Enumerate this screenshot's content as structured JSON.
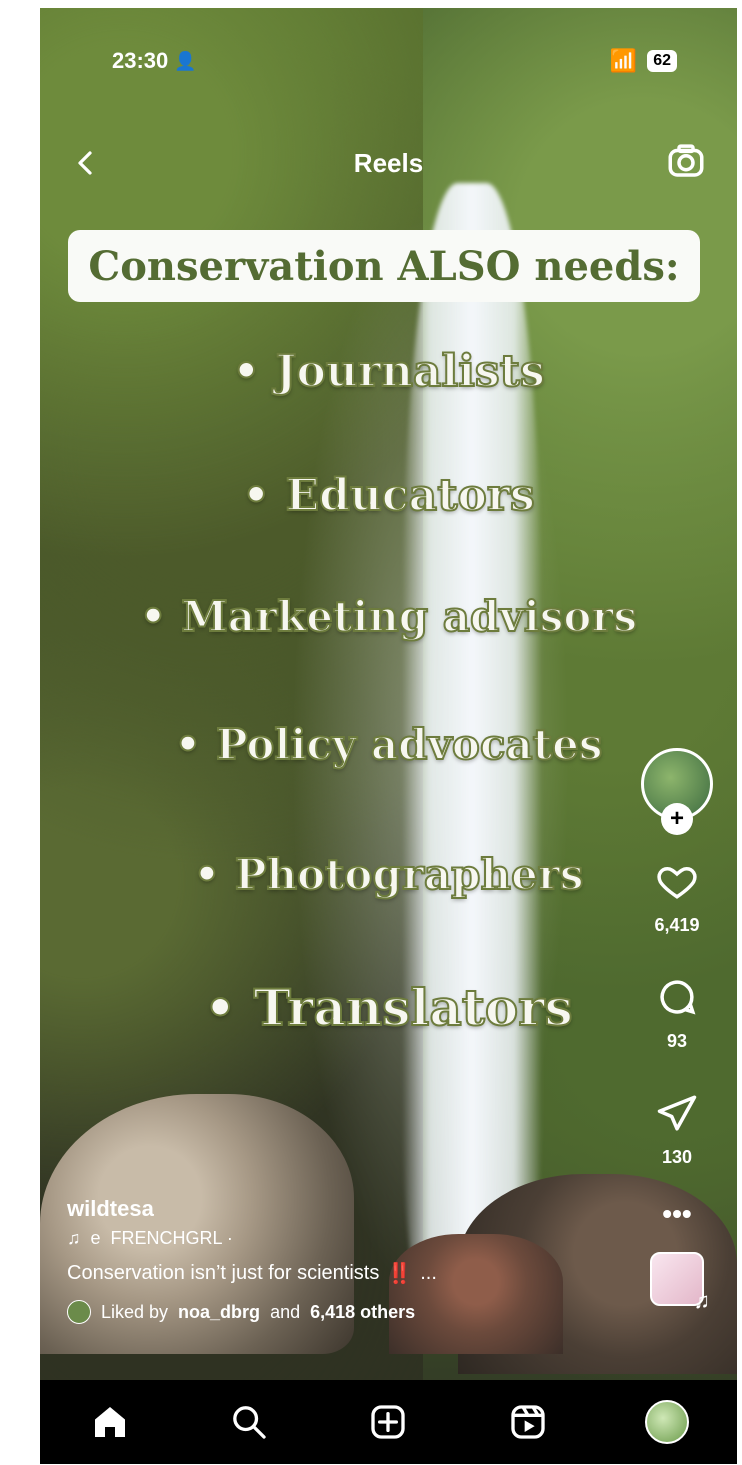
{
  "status": {
    "time": "23:30",
    "battery": "62"
  },
  "header": {
    "title": "Reels"
  },
  "overlay": {
    "banner": "Conservation ALSO needs:",
    "items": [
      "• Journalists",
      "• Educators",
      "• Marketing advisors",
      "• Policy advocates",
      "• Photographers",
      "• Translators"
    ]
  },
  "actions": {
    "likes": "6,419",
    "comments": "93",
    "shares": "130"
  },
  "post": {
    "username": "wildtesa",
    "audio_prefix": "e",
    "audio": "FRENCHGRL ·",
    "caption": "Conservation isn’t just for scientists",
    "caption_emoji": "‼️",
    "caption_more": "...",
    "liked_by_prefix": "Liked by",
    "liked_by_user": "noa_dbrg",
    "liked_by_mid": "and",
    "liked_by_count": "6,418 others"
  },
  "icons": {
    "back": "chevron-left-icon",
    "camera": "camera-icon",
    "like": "heart-icon",
    "comment": "comment-icon",
    "share": "send-icon",
    "more": "more-icon",
    "home": "home-icon",
    "search": "search-icon",
    "create": "plus-square-icon",
    "reels": "reels-icon",
    "profile": "profile-avatar"
  },
  "colors": {
    "banner_text": "#546c33",
    "banner_bg": "#f9faf7",
    "outline": "#6d7c3d"
  }
}
